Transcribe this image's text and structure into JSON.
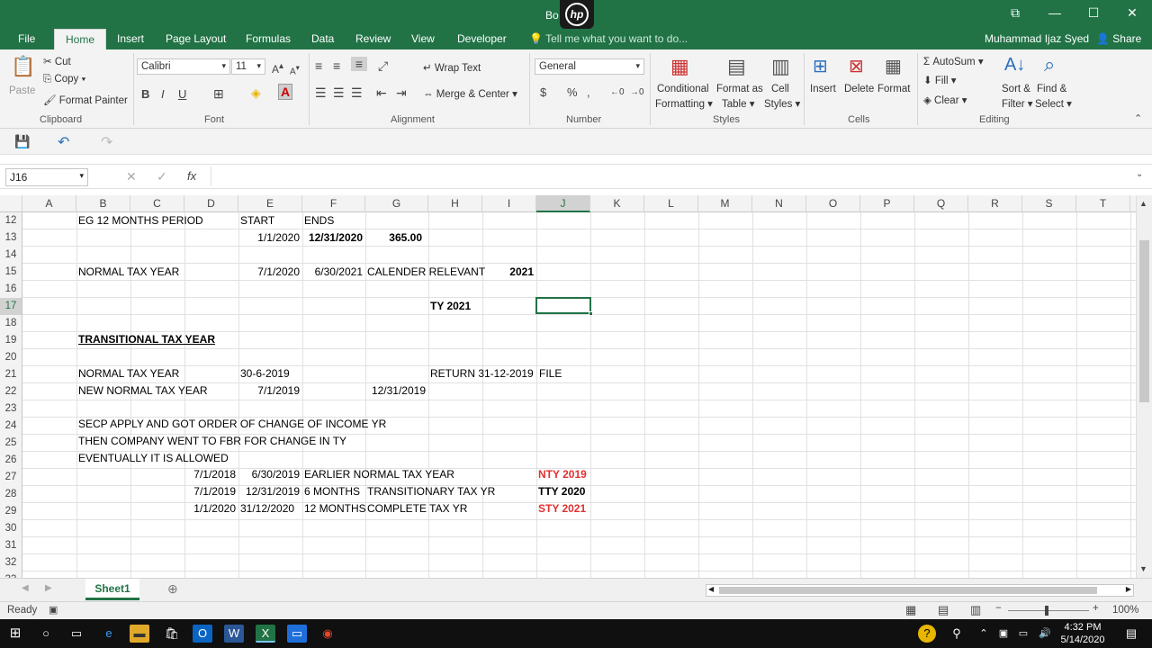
{
  "window": {
    "title": "Bo    xcel"
  },
  "tabs": [
    "File",
    "Home",
    "Insert",
    "Page Layout",
    "Formulas",
    "Data",
    "Review",
    "View",
    "Developer"
  ],
  "tell_me": "Tell me what you want to do...",
  "user": "Muhammad Ijaz Syed",
  "share": "Share",
  "ribbon": {
    "clipboard": {
      "paste": "Paste",
      "cut": "Cut",
      "copy": "Copy",
      "format_painter": "Format Painter",
      "label": "Clipboard"
    },
    "font": {
      "name": "Calibri",
      "size": "11",
      "label": "Font"
    },
    "alignment": {
      "wrap": "Wrap Text",
      "merge": "Merge & Center",
      "label": "Alignment"
    },
    "number": {
      "format": "General",
      "label": "Number"
    },
    "styles": {
      "conditional": "Conditional",
      "formatting": "Formatting",
      "format_as": "Format as",
      "table": "Table",
      "cell": "Cell",
      "styles": "Styles",
      "label": "Styles"
    },
    "cells": {
      "insert": "Insert",
      "delete": "Delete",
      "format": "Format",
      "label": "Cells"
    },
    "editing": {
      "autosum": "AutoSum",
      "fill": "Fill",
      "clear": "Clear",
      "sort": "Sort &",
      "filter": "Filter",
      "find": "Find &",
      "select": "Select",
      "label": "Editing"
    }
  },
  "name_box": "J16",
  "fx": "fx",
  "columns": [
    "A",
    "B",
    "C",
    "D",
    "E",
    "F",
    "G",
    "H",
    "I",
    "J",
    "K",
    "L",
    "M",
    "N",
    "O",
    "P",
    "Q",
    "R",
    "S",
    "T"
  ],
  "rows": [
    "12",
    "13",
    "14",
    "15",
    "16",
    "17",
    "18",
    "19",
    "20",
    "21",
    "22",
    "23",
    "24",
    "25",
    "26",
    "27",
    "28",
    "29",
    "30",
    "31",
    "32",
    "33"
  ],
  "cells": {
    "r12": {
      "b": "EG 12 MONTHS PERIOD",
      "e": "START",
      "f": "ENDS"
    },
    "r13": {
      "e": "1/1/2020",
      "f": "12/31/2020",
      "g": "365.00"
    },
    "r15": {
      "b": "NORMAL TAX YEAR",
      "e": "7/1/2020",
      "f": "6/30/2021",
      "g": "CALENDER RELEVANT",
      "i": "2021"
    },
    "r17": {
      "h": "TY 2021"
    },
    "r19": {
      "b": "TRANSITIONAL TAX YEAR"
    },
    "r21": {
      "b": "NORMAL TAX YEAR",
      "e": "30-6-2019",
      "h": "RETURN 31-12-2019",
      "j": "FILE"
    },
    "r22": {
      "b": "NEW NORMAL TAX YEAR",
      "e": "7/1/2019",
      "g": "12/31/2019"
    },
    "r24": {
      "b": "SECP APPLY AND GOT ORDER OF CHANGE OF INCOME YR"
    },
    "r25": {
      "b": "THEN COMPANY WENT TO FBR FOR CHANGE IN TY"
    },
    "r26": {
      "b": "EVENTUALLY IT IS ALLOWED"
    },
    "r27": {
      "d": "7/1/2018",
      "e": "6/30/2019",
      "f": "EARLIER NORMAL TAX YEAR",
      "j": "NTY 2019"
    },
    "r28": {
      "d": "7/1/2019",
      "e": "12/31/2019",
      "f": "6 MONTHS",
      "g": "TRANSITIONARY TAX YR",
      "j": "TTY 2020"
    },
    "r29": {
      "d": "1/1/2020",
      "e": "31/12/2020",
      "f": "12 MONTHS",
      "g": "COMPLETE TAX YR",
      "j": "STY 2021"
    }
  },
  "sheet_tab": "Sheet1",
  "status": {
    "ready": "Ready",
    "zoom": "100%"
  },
  "clock": {
    "time": "4:32 PM",
    "date": "5/14/2020"
  },
  "colors": {
    "excel_green": "#217346",
    "red_text": "#e03030"
  }
}
